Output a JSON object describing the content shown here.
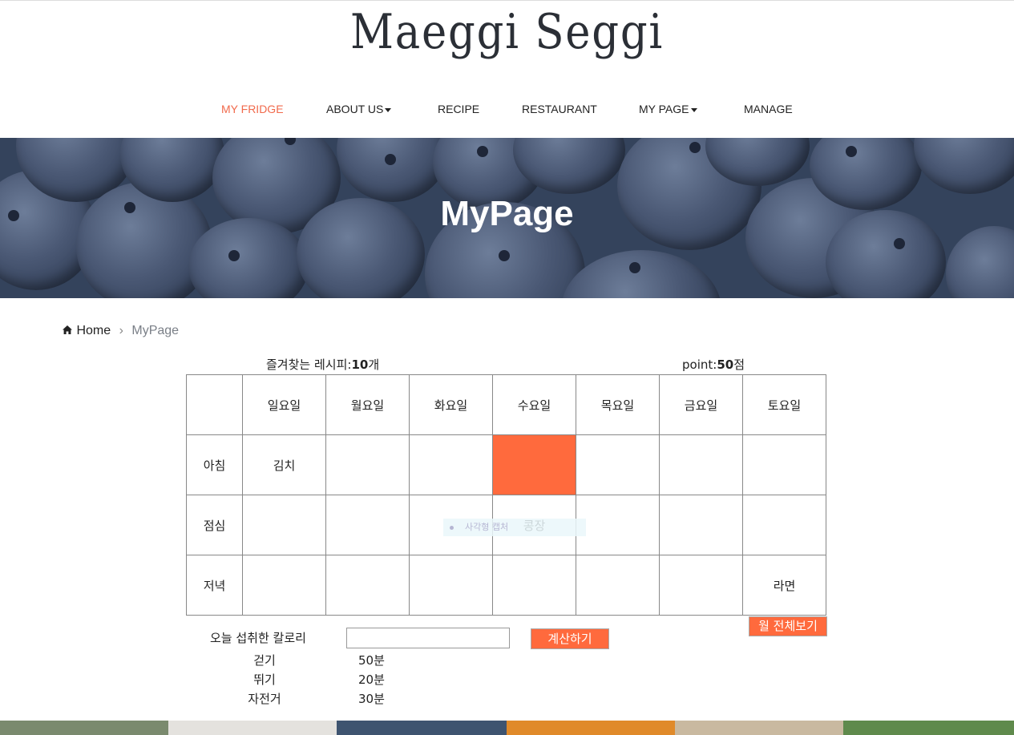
{
  "brand": {
    "logo_text": "Maeggi Seggi"
  },
  "nav": {
    "items": [
      {
        "label": "MY FRIDGE",
        "active": true,
        "dropdown": false
      },
      {
        "label": "ABOUT US",
        "active": false,
        "dropdown": true
      },
      {
        "label": "RECIPE",
        "active": false,
        "dropdown": false
      },
      {
        "label": "RESTAURANT",
        "active": false,
        "dropdown": false
      },
      {
        "label": "MY PAGE",
        "active": false,
        "dropdown": true
      },
      {
        "label": "MANAGE",
        "active": false,
        "dropdown": false
      }
    ]
  },
  "hero": {
    "title": "MyPage"
  },
  "breadcrumb": {
    "home_label": "Home",
    "current": "MyPage"
  },
  "stats": {
    "favorites_prefix": "즐겨찾는 레시피:",
    "favorites_count": "10",
    "favorites_suffix": "개",
    "point_prefix": "point:",
    "point_value": "50",
    "point_suffix": "점"
  },
  "schedule": {
    "days": [
      "일요일",
      "월요일",
      "화요일",
      "수요일",
      "목요일",
      "금요일",
      "토요일"
    ],
    "rows": [
      {
        "label": "아침",
        "cells": [
          "김치",
          "",
          "",
          "",
          "",
          "",
          ""
        ]
      },
      {
        "label": "점심",
        "cells": [
          "",
          "",
          "",
          "콩장",
          "",
          "",
          ""
        ]
      },
      {
        "label": "저녁",
        "cells": [
          "",
          "",
          "",
          "",
          "",
          "",
          "라면"
        ]
      }
    ],
    "tooltip_text": "사각형 캡처"
  },
  "calorie": {
    "label": "오늘 섭취한 칼로리",
    "input_value": "",
    "calc_button": "계산하기",
    "month_button": "월 전체보기"
  },
  "exercise": [
    {
      "name": "걷기",
      "value": "50분"
    },
    {
      "name": "뛰기",
      "value": "20분"
    },
    {
      "name": "자전거",
      "value": "30분"
    }
  ],
  "colors": {
    "accent": "#ff6a3d",
    "nav_active": "#f16a4c",
    "hero_bg": "#34435c"
  }
}
